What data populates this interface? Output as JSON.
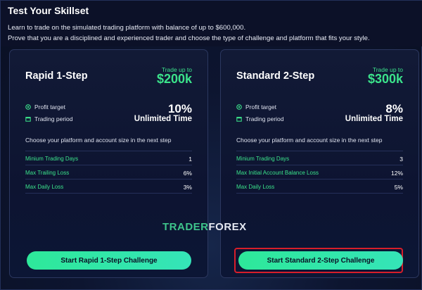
{
  "header": {
    "title": "Test Your Skillset",
    "intro_line1": "Learn to trade on the simulated trading platform with balance of up to $600,000.",
    "intro_line2": "Prove that you are a disciplined and experienced trader and choose the type of challenge and platform that fits your style."
  },
  "cards": [
    {
      "name": "Rapid 1-Step",
      "trade_label": "Trade up to",
      "trade_amount": "$200k",
      "profit_label": "Profit target",
      "profit_value": "10%",
      "period_label": "Trading period",
      "period_value": "Unlimited Time",
      "choose_text": "Choose your platform and account size in the next step",
      "stats": [
        {
          "label": "Minium Trading Days",
          "value": "1"
        },
        {
          "label": "Max Trailing Loss",
          "value": "6%"
        },
        {
          "label": "Max Daily Loss",
          "value": "3%"
        }
      ],
      "cta": "Start Rapid 1-Step Challenge"
    },
    {
      "name": "Standard 2-Step",
      "trade_label": "Trade up to",
      "trade_amount": "$300k",
      "profit_label": "Profit target",
      "profit_value": "8%",
      "period_label": "Trading period",
      "period_value": "Unlimited Time",
      "choose_text": "Choose your platform and account size in the next step",
      "stats": [
        {
          "label": "Minium Trading Days",
          "value": "3"
        },
        {
          "label": "Max Initial Account Balance Loss",
          "value": "12%"
        },
        {
          "label": "Max Daily Loss",
          "value": "5%"
        }
      ],
      "cta": "Start Standard 2-Step Challenge"
    }
  ],
  "watermark": {
    "part1": "TRADER",
    "part2": "FOREX"
  },
  "colors": {
    "accent": "#3be38b",
    "highlight_border": "#d81e2a",
    "background": "#0a1024"
  }
}
